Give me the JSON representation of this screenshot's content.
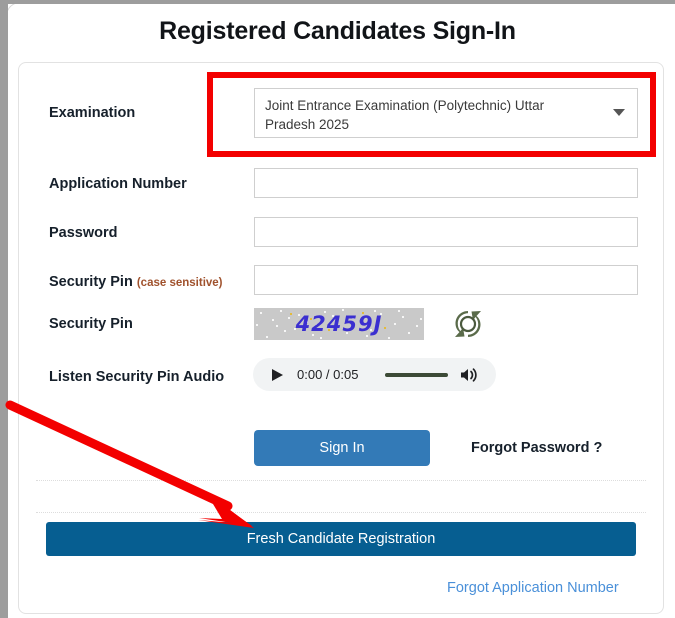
{
  "page": {
    "title": "Registered Candidates Sign-In"
  },
  "form": {
    "examination": {
      "label": "Examination",
      "selected_option": "Joint Entrance Examination (Polytechnic) Uttar Pradesh 2025",
      "options": [
        "Joint Entrance Examination (Polytechnic) Uttar Pradesh 2025"
      ],
      "arrow_icon": "chevron-down-icon"
    },
    "application_number": {
      "label": "Application Number",
      "value": "",
      "placeholder": ""
    },
    "password": {
      "label": "Password",
      "value": "",
      "placeholder": ""
    },
    "security_pin_input": {
      "label": "Security Pin",
      "note": "(case sensitive)",
      "value": "",
      "placeholder": ""
    },
    "security_pin_image": {
      "label": "Security Pin",
      "captcha_text": "42459J",
      "refresh_icon": "refresh-icon"
    },
    "audio": {
      "label": "Listen Security Pin Audio",
      "play_icon": "play-icon",
      "time": "0:00 / 0:05",
      "current_time": "0:00",
      "duration": "0:05",
      "volume_icon": "volume-icon"
    }
  },
  "actions": {
    "sign_in": "Sign In",
    "forgot_password": "Forgot Password ?",
    "fresh_registration": "Fresh Candidate Registration",
    "forgot_application_number": "Forgot Application Number"
  },
  "colors": {
    "sign_in_blue": "#337ab7",
    "registration_blue": "#065e91",
    "link_blue": "#4a90d9",
    "annotation_red": "#f30000",
    "note_brown": "#a0522d",
    "captcha_blue": "#3b2fd0"
  }
}
